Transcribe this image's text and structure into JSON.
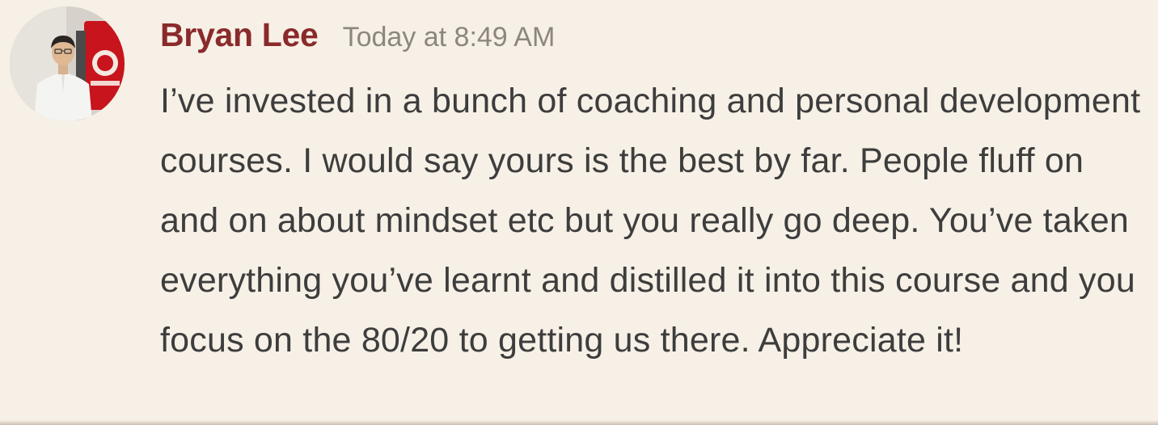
{
  "message": {
    "author": "Bryan Lee",
    "timestamp": "Today at 8:49 AM",
    "text": "I’ve invested in a bunch of coaching and personal development courses. I would say yours is the best by far. People fluff on and on about mindset etc but you really go deep. You’ve taken everything you’ve learnt and distilled it into this course and you focus on the 80/20 to getting us there. Appreciate it!"
  },
  "colors": {
    "background": "#f7f0e6",
    "author": "#8a2a2b",
    "timestamp": "#8c8680",
    "body_text": "#3d3d3d"
  }
}
